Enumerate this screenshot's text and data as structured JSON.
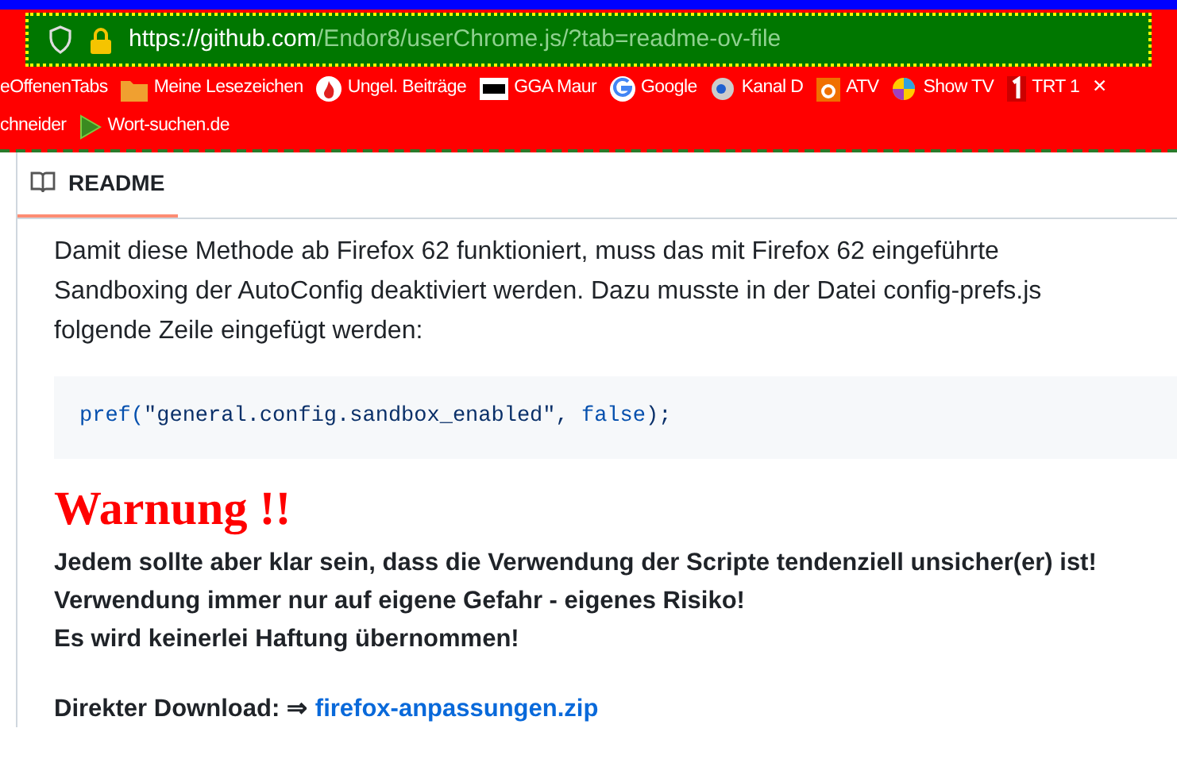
{
  "address_bar": {
    "url_host": "https://github.com",
    "url_path": "/Endor8/userChrome.js/?tab=readme-ov-file"
  },
  "bookmarks_rows": [
    [
      {
        "label": "eOffenenTabs"
      },
      {
        "label": "Meine Lesezeichen"
      },
      {
        "label": "Ungel. Beiträge"
      },
      {
        "label": "GGA Maur"
      },
      {
        "label": "Google"
      },
      {
        "label": "Kanal D"
      },
      {
        "label": "ATV"
      },
      {
        "label": "Show TV"
      },
      {
        "label": "TRT 1"
      },
      {
        "label": "✕"
      }
    ],
    [
      {
        "label": "chneider"
      },
      {
        "label": "Wort-suchen.de"
      }
    ]
  ],
  "tab": {
    "label": "README",
    "selected": true
  },
  "intro_lines": [
    "Damit diese Methode ab Firefox 62 funktioniert, muss das mit Firefox 62 eingeführte",
    "Sandboxing der AutoConfig deaktiviert werden. Dazu musste in der Datei config-prefs.js",
    "folgende Zeile eingefügt werden:"
  ],
  "code_tokens": [
    {
      "text": "pref(",
      "kind": "fn"
    },
    {
      "text": "\"general.config.sandbox_enabled\", ",
      "kind": "str"
    },
    {
      "text": "false",
      "kind": "kw"
    },
    {
      "text": ");",
      "kind": "str"
    }
  ],
  "warning_heading": "Warnung !!",
  "warning_lines": [
    "Jedem sollte aber klar sein, dass die Verwendung der Scripte tendenziell unsicher(er) ist!",
    "Verwendung immer nur auf eigene Gefahr - eigenes Risiko!",
    "Es wird keinerlei Haftung übernommen!"
  ],
  "download": {
    "label": "Direkter Download: ⇒",
    "link": "firefox-anpassungen.zip"
  }
}
